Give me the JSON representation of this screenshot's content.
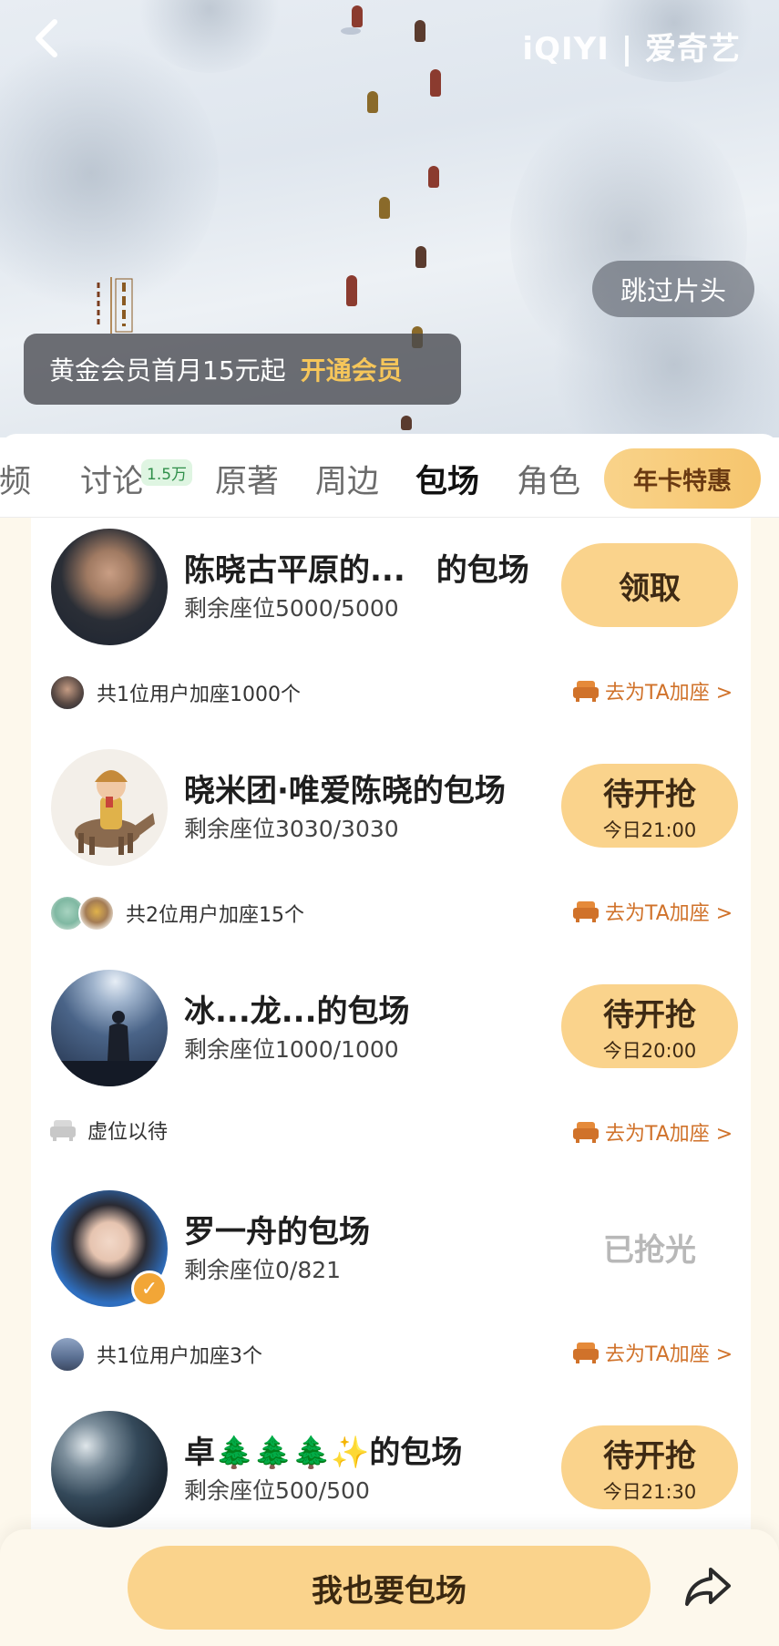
{
  "player": {
    "logo": "iQIYI | 爱奇艺",
    "skip_label": "跳过片头",
    "vip_banner": {
      "text": "黄金会员首月15元起",
      "link": "开通会员"
    }
  },
  "tabs": {
    "items": [
      "视频",
      "讨论",
      "原著",
      "周边",
      "包场",
      "角色"
    ],
    "discussion_badge": "1.5万",
    "active": "包场",
    "promo_button": "年卡特惠"
  },
  "cards": [
    {
      "title": "陈晓古平原的...　的包场",
      "seats": "剩余座位5000/5000",
      "action": "领取",
      "action_sub": "",
      "footer": "共1位用户加座1000个",
      "footer_link": "去为TA加座 >"
    },
    {
      "title": "晓米团·唯爱陈晓的包场",
      "seats": "剩余座位3030/3030",
      "action": "待开抢",
      "action_sub": "今日21:00",
      "footer": "共2位用户加座15个",
      "footer_link": "去为TA加座 >"
    },
    {
      "title": "冰...龙...的包场",
      "seats": "剩余座位1000/1000",
      "action": "待开抢",
      "action_sub": "今日20:00",
      "footer": "虚位以待",
      "footer_link": "去为TA加座 >"
    },
    {
      "title": "罗一舟的包场",
      "seats": "剩余座位0/821",
      "action": "已抢光",
      "action_sub": "",
      "footer": "共1位用户加座3个",
      "footer_link": "去为TA加座 >"
    },
    {
      "title": "卓🌲🌲🌲✨的包场",
      "seats": "剩余座位500/500",
      "action": "待开抢",
      "action_sub": "今日21:30",
      "footer": "",
      "footer_link": ""
    }
  ],
  "bottom": {
    "cta": "我也要包场"
  },
  "colors": {
    "accent": "#fad38c",
    "link": "#d0722a",
    "bg": "#fdf8ec"
  }
}
